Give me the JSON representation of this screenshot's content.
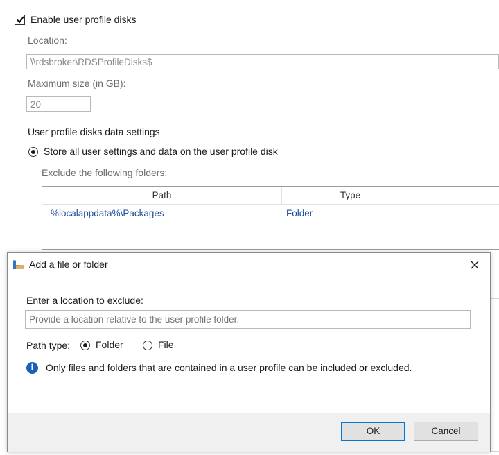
{
  "settings": {
    "enable_label": "Enable user profile disks",
    "enable_checked": true,
    "location_label": "Location:",
    "location_value": "\\\\rdsbroker\\RDSProfileDisks$",
    "max_size_label": "Maximum size (in GB):",
    "max_size_value": "20",
    "data_settings_heading": "User profile disks data settings",
    "store_all_label": "Store all user settings and data on the user profile disk",
    "exclude_label": "Exclude the following folders:",
    "table": {
      "columns": [
        "Path",
        "Type"
      ],
      "rows": [
        {
          "path": "%localappdata%\\Packages",
          "type": "Folder"
        }
      ]
    }
  },
  "dialog": {
    "title": "Add a file or folder",
    "location_label": "Enter a location to exclude:",
    "location_placeholder": "Provide a location relative to the user profile folder.",
    "path_type_label": "Path type:",
    "options": [
      "Folder",
      "File"
    ],
    "selected_option": "Folder",
    "info_text": "Only files and folders that are contained in a user profile can be included or excluded.",
    "ok_label": "OK",
    "cancel_label": "Cancel"
  },
  "colors": {
    "accent": "#0078d7",
    "link_text": "#1f4e9c",
    "info_icon": "#1c5fb8"
  },
  "icons": {
    "dialog_icon": "folder-add-icon",
    "close_icon": "close-icon",
    "info_icon": "info-icon"
  }
}
